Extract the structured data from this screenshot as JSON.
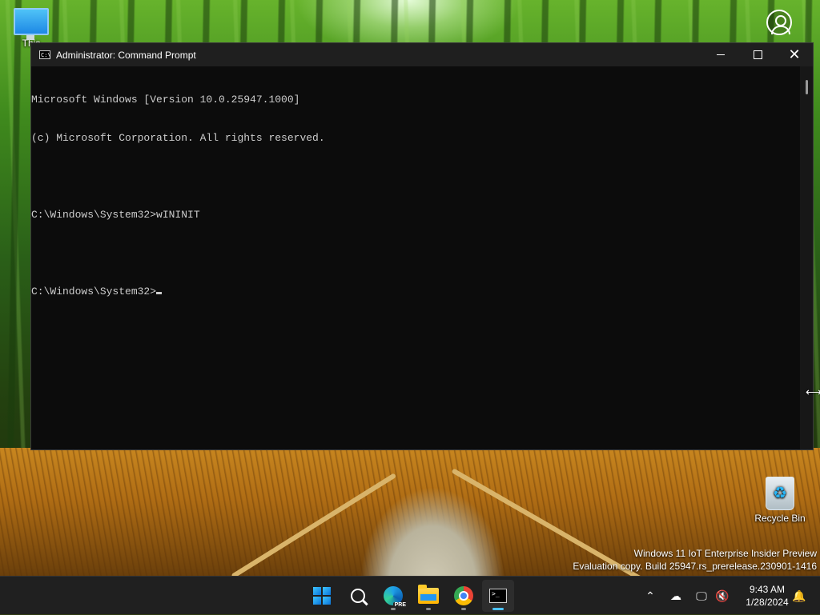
{
  "desktop": {
    "icons": [
      {
        "label": "This"
      },
      {
        "label": "Recycle Bin"
      }
    ],
    "watermark": {
      "line1": "Windows 11 IoT Enterprise Insider Preview",
      "line2": "Evaluation copy. Build 25947.rs_prerelease.230901-1416"
    }
  },
  "window": {
    "title": "Administrator: Command Prompt",
    "app_icon_text": "C:\\",
    "console_lines": [
      "Microsoft Windows [Version 10.0.25947.1000]",
      "(c) Microsoft Corporation. All rights reserved.",
      "",
      "C:\\Windows\\System32>wININIT",
      "",
      "C:\\Windows\\System32>"
    ]
  },
  "taskbar": {
    "apps": [
      {
        "name": "start-button",
        "icon": "windows-logo-icon"
      },
      {
        "name": "search-button",
        "icon": "search-icon"
      },
      {
        "name": "edge-button",
        "icon": "edge-icon",
        "badge": "PRE"
      },
      {
        "name": "file-explorer-button",
        "icon": "folder-icon"
      },
      {
        "name": "chrome-button",
        "icon": "chrome-icon"
      },
      {
        "name": "terminal-button",
        "icon": "terminal-icon",
        "active": true
      }
    ],
    "tray": {
      "time": "9:43 AM",
      "date": "1/28/2024"
    }
  },
  "colors": {
    "console_bg": "#0c0c0c",
    "console_fg": "#cccccc",
    "titlebar_bg": "#1f1f1f",
    "taskbar_bg": "#202020",
    "accent": "#4cc2ff"
  }
}
